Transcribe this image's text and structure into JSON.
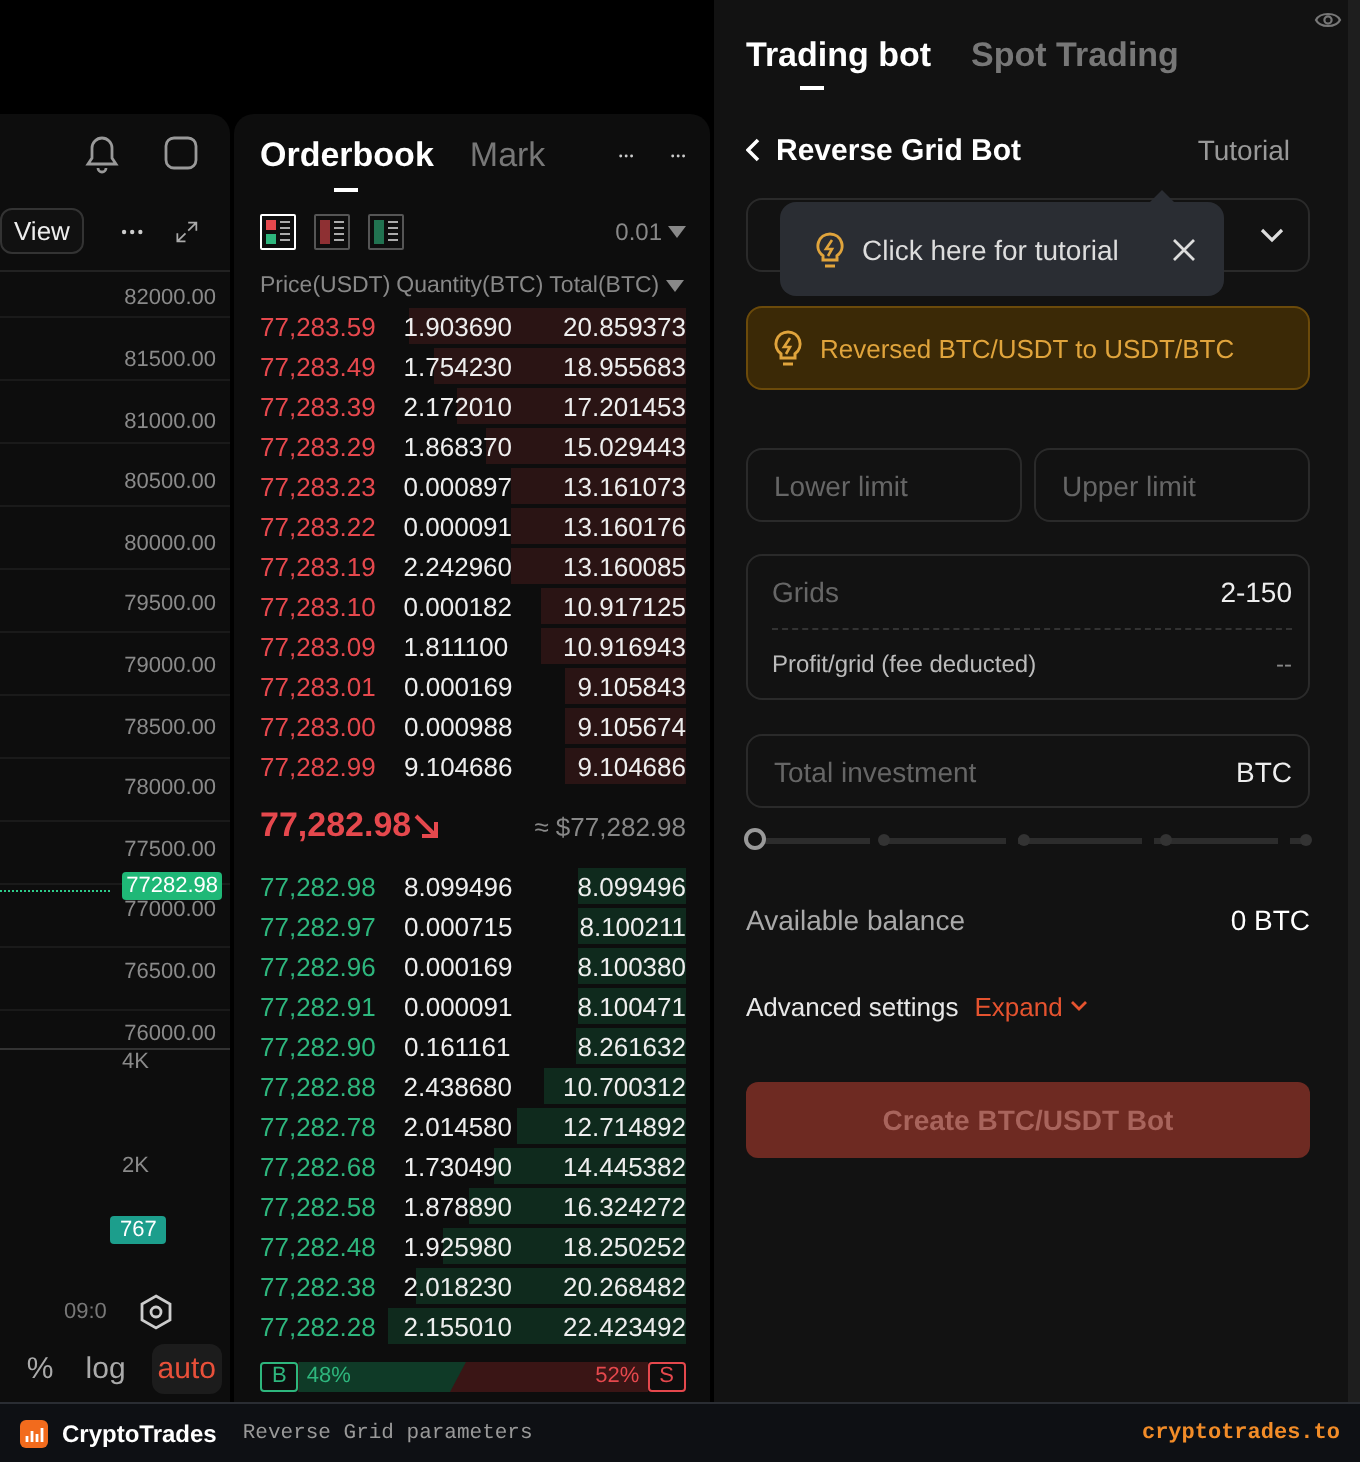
{
  "chart_panel": {
    "view_button": "View",
    "price_axis": [
      "82000.00",
      "81500.00",
      "81000.00",
      "80500.00",
      "80000.00",
      "79500.00",
      "79000.00",
      "78500.00",
      "78000.00",
      "77500.00",
      "77000.00",
      "76500.00",
      "76000.00"
    ],
    "last_price_tag": "77282.98",
    "volume_axis": [
      "4K",
      "2K"
    ],
    "volume_tag": "767",
    "time_label": "09:0",
    "scale_options": [
      {
        "label": "%",
        "selected": false
      },
      {
        "label": "log",
        "selected": false
      },
      {
        "label": "auto",
        "selected": true
      }
    ]
  },
  "orderbook": {
    "tabs": [
      {
        "label": "Orderbook",
        "selected": true
      },
      {
        "label": "Mark",
        "selected": false
      }
    ],
    "view_modes": [
      {
        "kind": "both",
        "selected": true
      },
      {
        "kind": "asks",
        "selected": false
      },
      {
        "kind": "bids",
        "selected": false
      }
    ],
    "precision": "0.01",
    "columns": [
      "Price(USDT)",
      "Quantity(BTC)",
      "Total(BTC)"
    ],
    "asks": [
      {
        "price": "77,283.59",
        "quantity": "1.903690",
        "total": "20.859373"
      },
      {
        "price": "77,283.49",
        "quantity": "1.754230",
        "total": "18.955683"
      },
      {
        "price": "77,283.39",
        "quantity": "2.172010",
        "total": "17.201453"
      },
      {
        "price": "77,283.29",
        "quantity": "1.868370",
        "total": "15.029443"
      },
      {
        "price": "77,283.23",
        "quantity": "0.000897",
        "total": "13.161073"
      },
      {
        "price": "77,283.22",
        "quantity": "0.000091",
        "total": "13.160176"
      },
      {
        "price": "77,283.19",
        "quantity": "2.242960",
        "total": "13.160085"
      },
      {
        "price": "77,283.10",
        "quantity": "0.000182",
        "total": "10.917125"
      },
      {
        "price": "77,283.09",
        "quantity": "1.811100",
        "total": "10.916943"
      },
      {
        "price": "77,283.01",
        "quantity": "0.000169",
        "total": "9.105843"
      },
      {
        "price": "77,283.00",
        "quantity": "0.000988",
        "total": "9.105674"
      },
      {
        "price": "77,282.99",
        "quantity": "9.104686",
        "total": "9.104686"
      }
    ],
    "last_price": "77,282.98",
    "last_price_usd": "≈ $77,282.98",
    "bids": [
      {
        "price": "77,282.98",
        "quantity": "8.099496",
        "total": "8.099496"
      },
      {
        "price": "77,282.97",
        "quantity": "0.000715",
        "total": "8.100211"
      },
      {
        "price": "77,282.96",
        "quantity": "0.000169",
        "total": "8.100380"
      },
      {
        "price": "77,282.91",
        "quantity": "0.000091",
        "total": "8.100471"
      },
      {
        "price": "77,282.90",
        "quantity": "0.161161",
        "total": "8.261632"
      },
      {
        "price": "77,282.88",
        "quantity": "2.438680",
        "total": "10.700312"
      },
      {
        "price": "77,282.78",
        "quantity": "2.014580",
        "total": "12.714892"
      },
      {
        "price": "77,282.68",
        "quantity": "1.730490",
        "total": "14.445382"
      },
      {
        "price": "77,282.58",
        "quantity": "1.878890",
        "total": "16.324272"
      },
      {
        "price": "77,282.48",
        "quantity": "1.925980",
        "total": "18.250252"
      },
      {
        "price": "77,282.38",
        "quantity": "2.018230",
        "total": "20.268482"
      },
      {
        "price": "77,282.28",
        "quantity": "2.155010",
        "total": "22.423492"
      }
    ],
    "ratio": {
      "buy_label": "B",
      "buy_percent": "48%",
      "sell_percent": "52%",
      "sell_label": "S",
      "level": 0.48
    }
  },
  "bot_panel": {
    "tabs": [
      {
        "label": "Trading bot",
        "selected": true
      },
      {
        "label": "Spot Trading",
        "selected": false
      }
    ],
    "title": "Reverse Grid Bot",
    "tutorial_link": "Tutorial",
    "tooltip": "Click here for tutorial",
    "notice": "Reversed BTC/USDT to USDT/BTC",
    "lower_limit": {
      "placeholder": "Lower limit"
    },
    "upper_limit": {
      "placeholder": "Upper limit"
    },
    "grids": {
      "placeholder": "Grids",
      "range": "2-150"
    },
    "profit_per_grid": {
      "label": "Profit/grid (fee deducted)",
      "value": "--"
    },
    "total_investment": {
      "placeholder": "Total investment",
      "unit": "BTC",
      "level": 0
    },
    "available_balance": {
      "label": "Available balance",
      "value": "0 BTC"
    },
    "advanced_settings": {
      "label": "Advanced settings",
      "toggle": "Expand",
      "expanded": false
    },
    "create_button": {
      "label": "Create BTC/USDT Bot",
      "disabled": true
    }
  },
  "footer": {
    "brand": "CryptoTrades",
    "caption": "Reverse Grid parameters",
    "url": "cryptotrades.to"
  }
}
